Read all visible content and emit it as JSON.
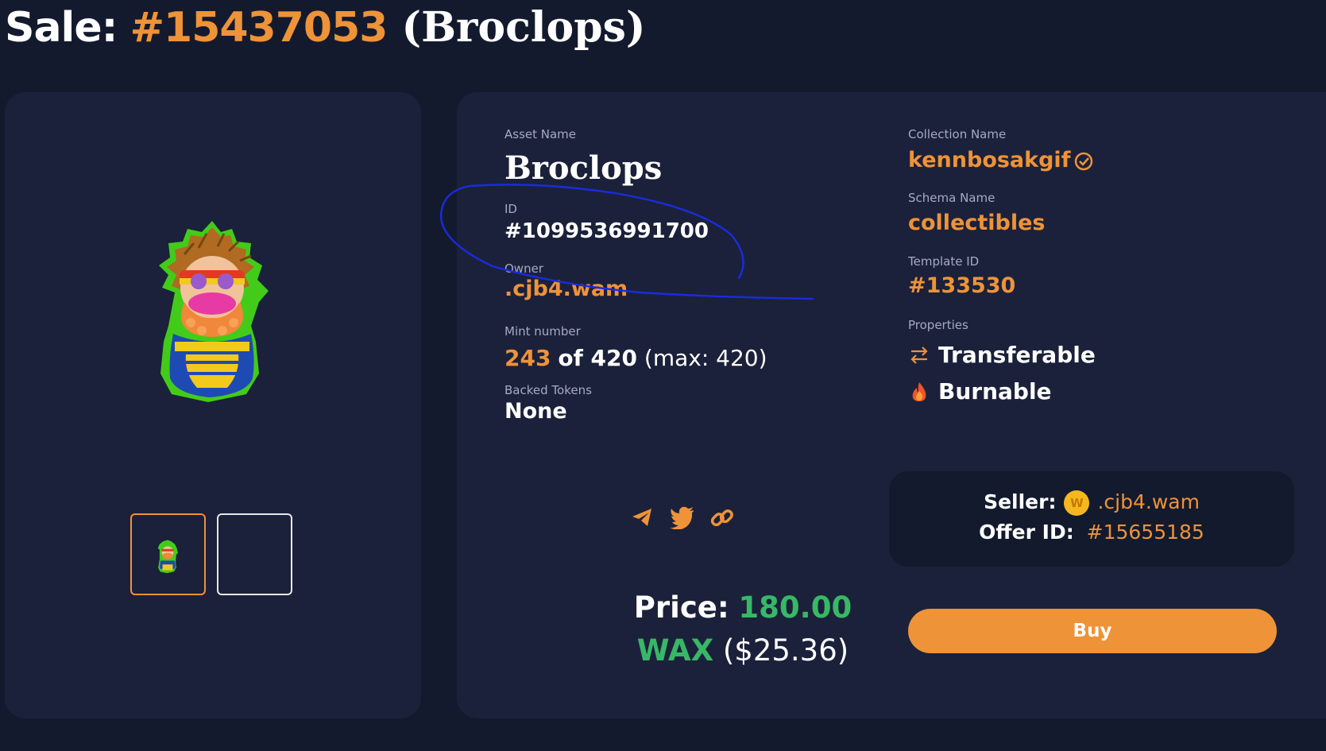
{
  "page": {
    "title_prefix": "Sale:",
    "sale_number": "#15437053",
    "title_name": "(Broclops)"
  },
  "asset": {
    "name_label": "Asset Name",
    "name": "Broclops",
    "id_label": "ID",
    "id": "#1099536991700",
    "owner_label": "Owner",
    "owner": ".cjb4.wam",
    "mint_label": "Mint number",
    "mint_number": "243",
    "mint_of": "of 420",
    "mint_max": "(max: 420)",
    "backed_label": "Backed Tokens",
    "backed": "None"
  },
  "collection": {
    "name_label": "Collection Name",
    "name": "kennbosakgif",
    "schema_label": "Schema Name",
    "schema": "collectibles",
    "template_label": "Template ID",
    "template": "#133530",
    "properties_label": "Properties",
    "properties": [
      "Transferable",
      "Burnable"
    ]
  },
  "price": {
    "label": "Price:",
    "amount": "180.00",
    "currency": "WAX",
    "usd": "($25.36)"
  },
  "seller": {
    "label": "Seller:",
    "coin_letter": "W",
    "name": ".cjb4.wam",
    "offer_label": "Offer ID:",
    "offer_id": "#15655185"
  },
  "actions": {
    "buy_label": "Buy",
    "share_icons": [
      "telegram-icon",
      "twitter-icon",
      "link-icon"
    ]
  },
  "colors": {
    "background": "#141a2e",
    "card": "#1b213a",
    "accent": "#ee9338",
    "price_green": "#37b866",
    "annotation_blue": "#1a2be0"
  }
}
